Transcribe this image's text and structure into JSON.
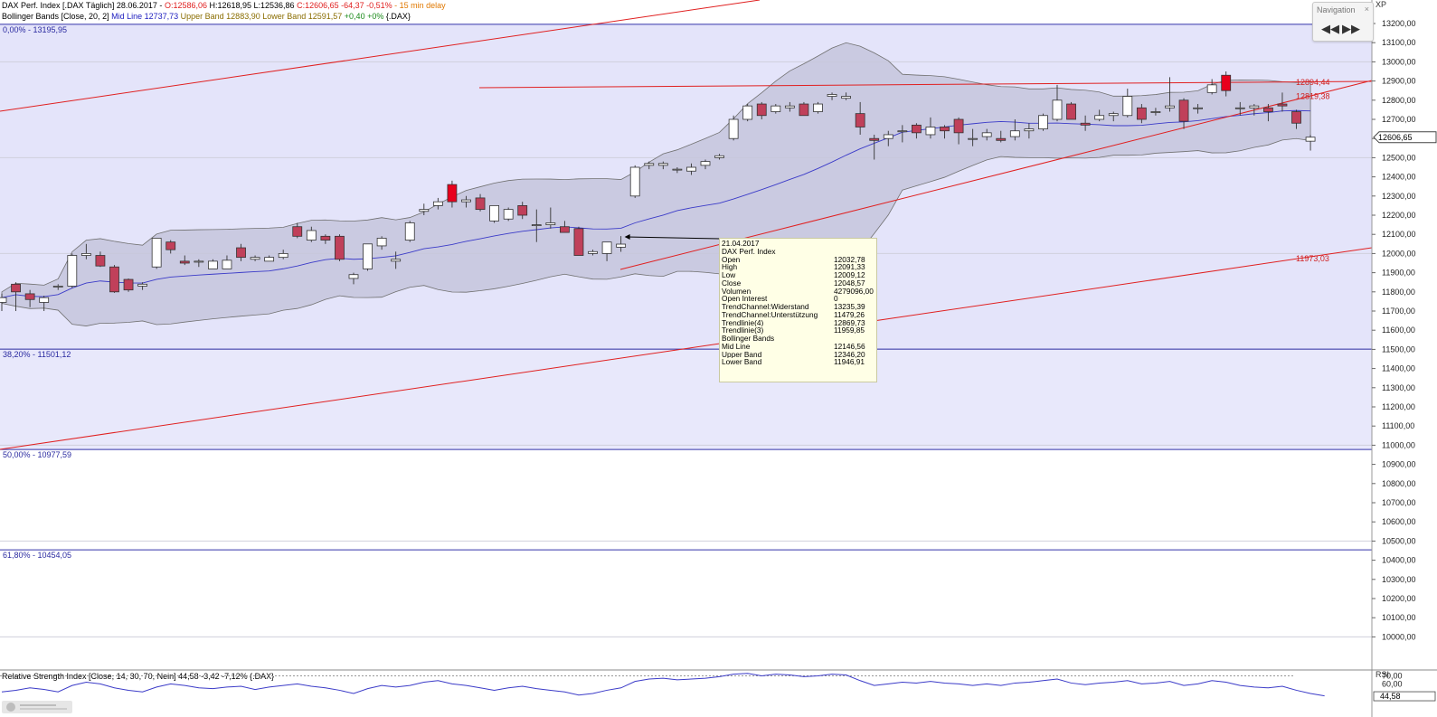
{
  "header": {
    "line1_prefix": "DAX Perf. Index [.DAX Täglich] 28.06.2017 - ",
    "line1_ohlc": "O:12586,06",
    "line1_hl": " H:12618,95 L:12536,86 ",
    "line1_close": "C:12606,65 -64,37 -0,51%",
    "line1_delay": " - 15 min delay",
    "line2_prefix": "Bollinger Bands [Close, 20, 2] ",
    "line2_mid": "Mid Line 12737,73",
    "line2_upper": " Upper Band 12883,90",
    "line2_lower": " Lower Band 12591,57",
    "line2_change": " +0,40 +0%",
    "line2_suffix": " {.DAX}"
  },
  "navigation": {
    "title": "Navigation",
    "close": "×",
    "back": "◀◀",
    "forward": "▶▶"
  },
  "xp_label": "XP",
  "price_badge": "12606,65",
  "tooltip": {
    "date": "21.04.2017",
    "instrument": "DAX Perf. Index",
    "rows": [
      {
        "label": "Open",
        "value": "12032,78"
      },
      {
        "label": "High",
        "value": "12091,33"
      },
      {
        "label": "Low",
        "value": "12009,12"
      },
      {
        "label": "Close",
        "value": "12048,57"
      },
      {
        "label": "Volumen",
        "value": "4279096,00"
      },
      {
        "label": "Open Interest",
        "value": "0"
      },
      {
        "label": "TrendChannel:Widerstand",
        "value": "13235,39"
      },
      {
        "label": "TrendChannel:Unterstützung",
        "value": "11479,26"
      },
      {
        "label": "Trendlinie(4)",
        "value": "12869,73"
      },
      {
        "label": "Trendlinie(3)",
        "value": "11959,85"
      }
    ],
    "section": "Bollinger Bands",
    "bb_rows": [
      {
        "label": "Mid Line",
        "value": "12146,56"
      },
      {
        "label": "Upper Band",
        "value": "12346,20"
      },
      {
        "label": "Lower Band",
        "value": "11946,91"
      }
    ]
  },
  "rsi_header": "Relative Strength Index [Close, 14, 30, 70, Nein] 44,58 -3,42 -7,12% {.DAX}",
  "colors": {
    "up": "#ffffff",
    "down": "#c0405a",
    "highlight": "#e8001c",
    "fib_line": "#3333aa",
    "trend": "#e02020",
    "mid": "#3b3bc8"
  },
  "chart_data": {
    "type": "candlestick",
    "title": "DAX Perf. Index [.DAX Täglich]",
    "ylim": [
      9900,
      13300
    ],
    "y_ticks": [
      "13200,00",
      "13100,00",
      "13000,00",
      "12900,00",
      "12800,00",
      "12700,00",
      "12600,00",
      "12500,00",
      "12400,00",
      "12300,00",
      "12200,00",
      "12100,00",
      "12000,00",
      "11900,00",
      "11800,00",
      "11700,00",
      "11600,00",
      "11500,00",
      "11400,00",
      "11300,00",
      "11200,00",
      "11100,00",
      "11000,00",
      "10900,00",
      "10800,00",
      "10700,00",
      "10600,00",
      "10500,00",
      "10400,00",
      "10300,00",
      "10200,00",
      "10100,00",
      "10000,00"
    ],
    "fib_levels": [
      {
        "label": "0,00% - 13195,95",
        "value": 13195.95
      },
      {
        "label": "38,20% - 11501,12",
        "value": 11501.12
      },
      {
        "label": "50,00% - 10977,59",
        "value": 10977.59
      },
      {
        "label": "61,80% - 10454,05",
        "value": 10454.05
      }
    ],
    "right_labels": [
      {
        "text": "12894,44",
        "value": 12894.44
      },
      {
        "text": "12819,38",
        "value": 12819.38
      },
      {
        "text": "11973,03",
        "value": 11973.03
      }
    ],
    "candles": [
      {
        "o": 11745,
        "h": 11790,
        "l": 11700,
        "c": 11770
      },
      {
        "o": 11840,
        "h": 11850,
        "l": 11700,
        "c": 11800
      },
      {
        "o": 11790,
        "h": 11810,
        "l": 11720,
        "c": 11760
      },
      {
        "o": 11745,
        "h": 11780,
        "l": 11700,
        "c": 11770
      },
      {
        "o": 11825,
        "h": 11840,
        "l": 11810,
        "c": 11830
      },
      {
        "o": 11830,
        "h": 12000,
        "l": 11820,
        "c": 11990
      },
      {
        "o": 11990,
        "h": 12050,
        "l": 11970,
        "c": 12000
      },
      {
        "o": 11990,
        "h": 12010,
        "l": 11930,
        "c": 11935
      },
      {
        "o": 11930,
        "h": 11940,
        "l": 11795,
        "c": 11800
      },
      {
        "o": 11865,
        "h": 11870,
        "l": 11800,
        "c": 11810
      },
      {
        "o": 11830,
        "h": 11850,
        "l": 11810,
        "c": 11840
      },
      {
        "o": 11930,
        "h": 12080,
        "l": 11920,
        "c": 12080
      },
      {
        "o": 12060,
        "h": 12070,
        "l": 12000,
        "c": 12020
      },
      {
        "o": 11960,
        "h": 11990,
        "l": 11940,
        "c": 11950
      },
      {
        "o": 11955,
        "h": 11970,
        "l": 11930,
        "c": 11960
      },
      {
        "o": 11920,
        "h": 11970,
        "l": 11920,
        "c": 11960
      },
      {
        "o": 11920,
        "h": 11990,
        "l": 11920,
        "c": 11965
      },
      {
        "o": 12030,
        "h": 12050,
        "l": 11960,
        "c": 11980
      },
      {
        "o": 11970,
        "h": 11990,
        "l": 11960,
        "c": 11980
      },
      {
        "o": 11960,
        "h": 11990,
        "l": 11960,
        "c": 11980
      },
      {
        "o": 11980,
        "h": 12020,
        "l": 11970,
        "c": 12000
      },
      {
        "o": 12140,
        "h": 12160,
        "l": 12080,
        "c": 12090
      },
      {
        "o": 12070,
        "h": 12140,
        "l": 12060,
        "c": 12120
      },
      {
        "o": 12090,
        "h": 12100,
        "l": 12050,
        "c": 12070
      },
      {
        "o": 12090,
        "h": 12100,
        "l": 11960,
        "c": 11970
      },
      {
        "o": 11870,
        "h": 11900,
        "l": 11840,
        "c": 11890
      },
      {
        "o": 11920,
        "h": 12050,
        "l": 11910,
        "c": 12050
      },
      {
        "o": 12040,
        "h": 12090,
        "l": 12020,
        "c": 12080
      },
      {
        "o": 11960,
        "h": 12010,
        "l": 11920,
        "c": 11970
      },
      {
        "o": 12070,
        "h": 12170,
        "l": 12060,
        "c": 12160
      },
      {
        "o": 12220,
        "h": 12260,
        "l": 12200,
        "c": 12230
      },
      {
        "o": 12250,
        "h": 12290,
        "l": 12230,
        "c": 12270
      },
      {
        "o": 12360,
        "h": 12380,
        "l": 12240,
        "c": 12270
      },
      {
        "o": 12270,
        "h": 12300,
        "l": 12240,
        "c": 12280
      },
      {
        "o": 12290,
        "h": 12310,
        "l": 12220,
        "c": 12230
      },
      {
        "o": 12170,
        "h": 12250,
        "l": 12160,
        "c": 12250
      },
      {
        "o": 12180,
        "h": 12240,
        "l": 12170,
        "c": 12230
      },
      {
        "o": 12250,
        "h": 12270,
        "l": 12180,
        "c": 12200
      },
      {
        "o": 12150,
        "h": 12230,
        "l": 12060,
        "c": 12150
      },
      {
        "o": 12150,
        "h": 12240,
        "l": 12130,
        "c": 12160
      },
      {
        "o": 12140,
        "h": 12170,
        "l": 12110,
        "c": 12110
      },
      {
        "o": 12130,
        "h": 12140,
        "l": 11990,
        "c": 11990
      },
      {
        "o": 12000,
        "h": 12020,
        "l": 11990,
        "c": 12010
      },
      {
        "o": 12000,
        "h": 12060,
        "l": 11960,
        "c": 12060
      },
      {
        "o": 12033,
        "h": 12091,
        "l": 12009,
        "c": 12049
      },
      {
        "o": 12300,
        "h": 12460,
        "l": 12290,
        "c": 12450
      },
      {
        "o": 12460,
        "h": 12480,
        "l": 12440,
        "c": 12470
      },
      {
        "o": 12460,
        "h": 12480,
        "l": 12440,
        "c": 12470
      },
      {
        "o": 12440,
        "h": 12450,
        "l": 12420,
        "c": 12440
      },
      {
        "o": 12430,
        "h": 12470,
        "l": 12410,
        "c": 12450
      },
      {
        "o": 12460,
        "h": 12490,
        "l": 12440,
        "c": 12480
      },
      {
        "o": 12500,
        "h": 12520,
        "l": 12490,
        "c": 12510
      },
      {
        "o": 12600,
        "h": 12720,
        "l": 12590,
        "c": 12700
      },
      {
        "o": 12700,
        "h": 12780,
        "l": 12690,
        "c": 12770
      },
      {
        "o": 12780,
        "h": 12790,
        "l": 12700,
        "c": 12720
      },
      {
        "o": 12740,
        "h": 12780,
        "l": 12730,
        "c": 12770
      },
      {
        "o": 12760,
        "h": 12790,
        "l": 12740,
        "c": 12770
      },
      {
        "o": 12780,
        "h": 12790,
        "l": 12720,
        "c": 12720
      },
      {
        "o": 12740,
        "h": 12790,
        "l": 12730,
        "c": 12780
      },
      {
        "o": 12820,
        "h": 12840,
        "l": 12800,
        "c": 12830
      },
      {
        "o": 12810,
        "h": 12840,
        "l": 12800,
        "c": 12820
      },
      {
        "o": 12730,
        "h": 12790,
        "l": 12620,
        "c": 12660
      },
      {
        "o": 12600,
        "h": 12620,
        "l": 12490,
        "c": 12590
      },
      {
        "o": 12600,
        "h": 12640,
        "l": 12560,
        "c": 12620
      },
      {
        "o": 12640,
        "h": 12670,
        "l": 12580,
        "c": 12640
      },
      {
        "o": 12670,
        "h": 12680,
        "l": 12600,
        "c": 12630
      },
      {
        "o": 12620,
        "h": 12710,
        "l": 12600,
        "c": 12660
      },
      {
        "o": 12660,
        "h": 12670,
        "l": 12600,
        "c": 12640
      },
      {
        "o": 12700,
        "h": 12710,
        "l": 12570,
        "c": 12630
      },
      {
        "o": 12600,
        "h": 12650,
        "l": 12560,
        "c": 12600
      },
      {
        "o": 12610,
        "h": 12650,
        "l": 12590,
        "c": 12630
      },
      {
        "o": 12600,
        "h": 12640,
        "l": 12580,
        "c": 12590
      },
      {
        "o": 12610,
        "h": 12700,
        "l": 12590,
        "c": 12640
      },
      {
        "o": 12640,
        "h": 12680,
        "l": 12600,
        "c": 12650
      },
      {
        "o": 12650,
        "h": 12730,
        "l": 12640,
        "c": 12720
      },
      {
        "o": 12700,
        "h": 12880,
        "l": 12690,
        "c": 12800
      },
      {
        "o": 12780,
        "h": 12790,
        "l": 12700,
        "c": 12700
      },
      {
        "o": 12680,
        "h": 12720,
        "l": 12640,
        "c": 12670
      },
      {
        "o": 12700,
        "h": 12750,
        "l": 12690,
        "c": 12720
      },
      {
        "o": 12720,
        "h": 12740,
        "l": 12690,
        "c": 12730
      },
      {
        "o": 12720,
        "h": 12860,
        "l": 12710,
        "c": 12820
      },
      {
        "o": 12760,
        "h": 12780,
        "l": 12680,
        "c": 12700
      },
      {
        "o": 12740,
        "h": 12760,
        "l": 12720,
        "c": 12740
      },
      {
        "o": 12760,
        "h": 12920,
        "l": 12740,
        "c": 12770
      },
      {
        "o": 12800,
        "h": 12810,
        "l": 12650,
        "c": 12690
      },
      {
        "o": 12760,
        "h": 12780,
        "l": 12730,
        "c": 12760
      },
      {
        "o": 12840,
        "h": 12910,
        "l": 12830,
        "c": 12880
      },
      {
        "o": 12930,
        "h": 12950,
        "l": 12820,
        "c": 12850
      },
      {
        "o": 12760,
        "h": 12790,
        "l": 12720,
        "c": 12760
      },
      {
        "o": 12760,
        "h": 12780,
        "l": 12720,
        "c": 12770
      },
      {
        "o": 12760,
        "h": 12780,
        "l": 12690,
        "c": 12740
      },
      {
        "o": 12780,
        "h": 12840,
        "l": 12740,
        "c": 12770
      },
      {
        "o": 12740,
        "h": 12750,
        "l": 12650,
        "c": 12680
      },
      {
        "o": 12586,
        "h": 12619,
        "l": 12537,
        "c": 12607
      }
    ],
    "highlight_indices": [
      32,
      87
    ],
    "rsi": {
      "ylim": [
        30,
        75
      ],
      "ticks": [
        "70,00",
        "60,00",
        "44,58"
      ],
      "values": [
        50,
        52,
        55,
        53,
        50,
        58,
        62,
        60,
        55,
        52,
        50,
        56,
        60,
        58,
        55,
        54,
        56,
        57,
        53,
        56,
        58,
        60,
        57,
        55,
        52,
        48,
        54,
        58,
        56,
        58,
        62,
        64,
        60,
        58,
        55,
        52,
        55,
        57,
        54,
        52,
        50,
        46,
        48,
        52,
        55,
        63,
        66,
        67,
        65,
        66,
        67,
        69,
        72,
        73,
        70,
        72,
        71,
        69,
        70,
        72,
        71,
        64,
        58,
        60,
        62,
        61,
        63,
        61,
        60,
        58,
        60,
        58,
        61,
        62,
        64,
        66,
        61,
        59,
        61,
        62,
        64,
        60,
        61,
        63,
        58,
        60,
        64,
        62,
        58,
        56,
        55,
        57,
        52,
        48,
        45
      ]
    }
  }
}
